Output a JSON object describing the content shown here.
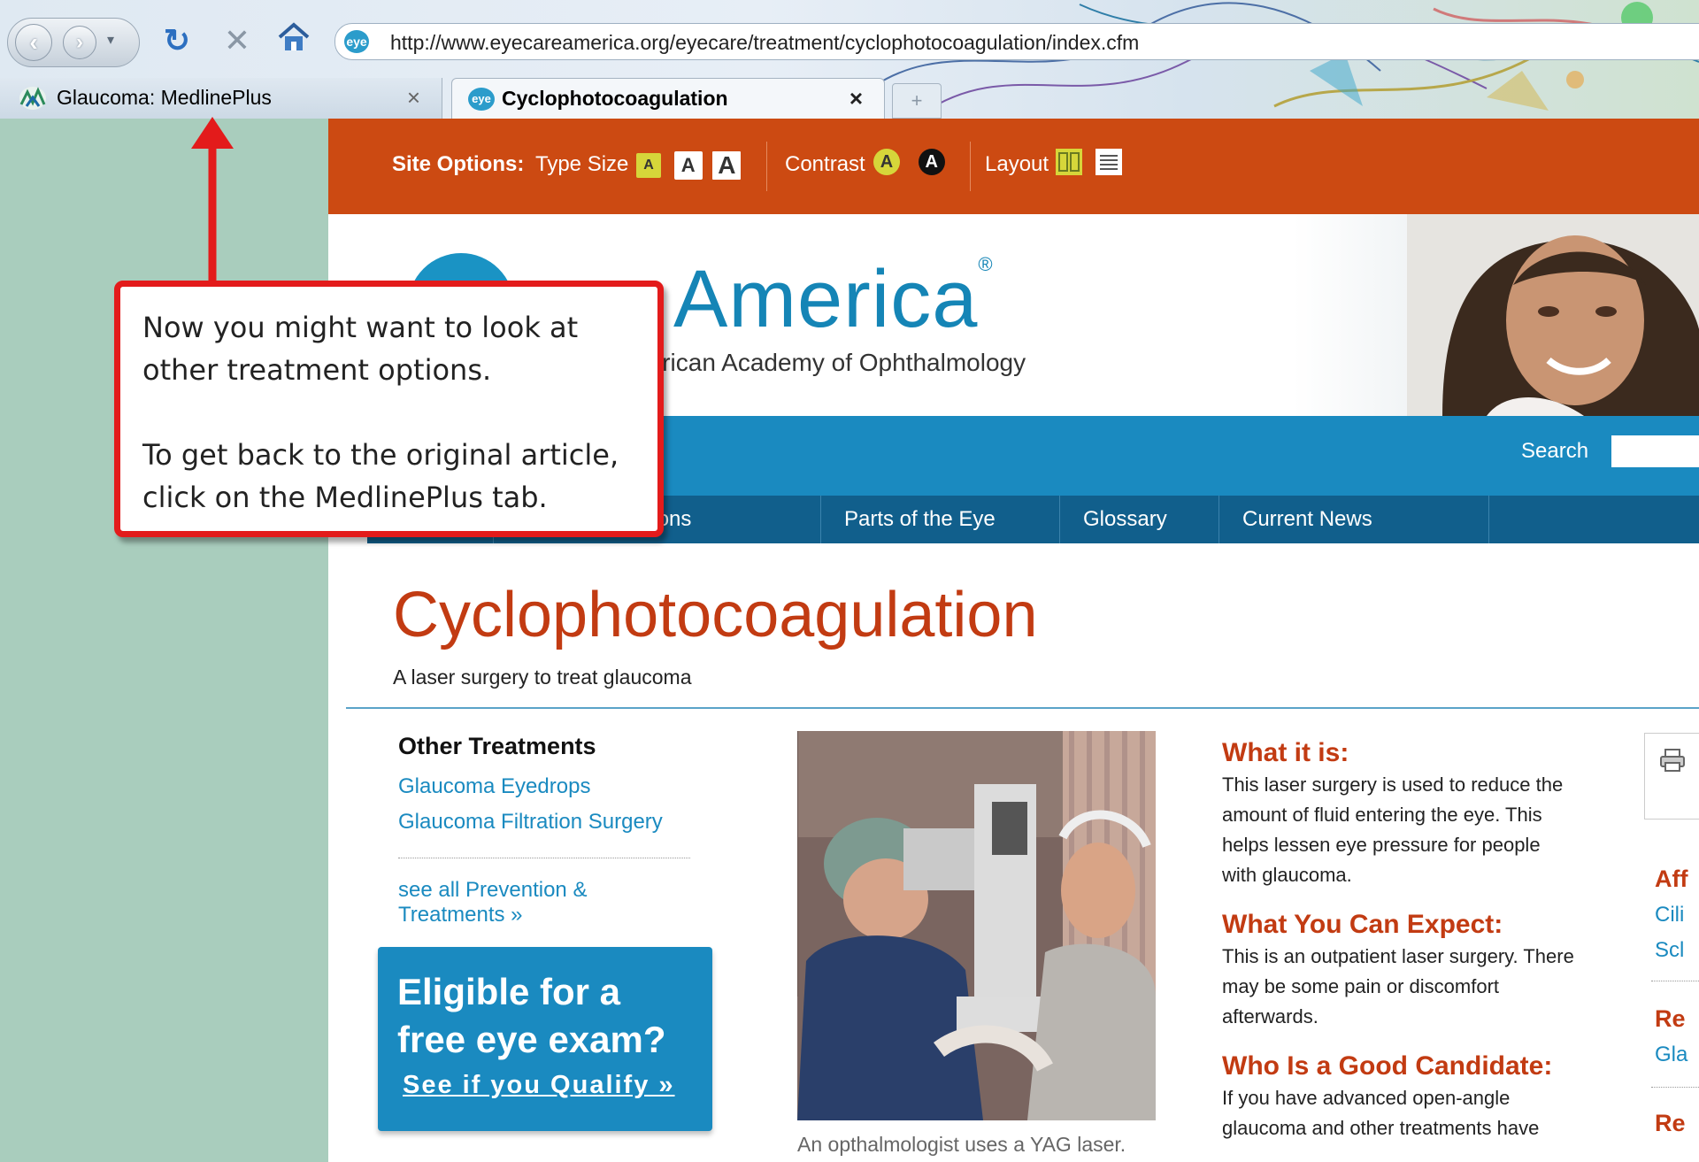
{
  "browser": {
    "url": "http://www.eyecareamerica.org/eyecare/treatment/cyclophotocoagulation/index.cfm",
    "url_favicon_text": "eye",
    "tabs": [
      {
        "label": "Glaucoma: MedlinePlus",
        "close": "×"
      },
      {
        "label": "Cyclophotocoagulation",
        "close": "×",
        "favicon_text": "eye"
      }
    ],
    "new_tab": "+"
  },
  "site_options": {
    "label": "Site Options:",
    "type_size_label": "Type Size",
    "type_size_options": [
      "A",
      "A",
      "A"
    ],
    "contrast_label": "Contrast",
    "contrast_options": [
      "A",
      "A"
    ],
    "layout_label": "Layout"
  },
  "header": {
    "logo_text": "America",
    "logo_registered": "®",
    "logo_subtitle": "n of the American Academy of Ophthalmology"
  },
  "search": {
    "label": "Search",
    "value": ""
  },
  "nav": [
    "Conditions",
    "Parts of the Eye",
    "Glossary",
    "Current News"
  ],
  "page": {
    "title": "Cyclophotocoagulation",
    "subtitle": "A laser surgery to treat glaucoma"
  },
  "other_treatments": {
    "heading": "Other Treatments",
    "links": [
      "Glaucoma Eyedrops",
      "Glaucoma Filtration Surgery"
    ],
    "see_all": "see all Prevention & Treatments »"
  },
  "promo": {
    "title": "Eligible for a free eye exam?",
    "link": "See if you Qualify »"
  },
  "photo": {
    "caption": "An opthalmologist uses a YAG laser."
  },
  "article": [
    {
      "heading": "What it is:",
      "body": "This laser surgery is used to reduce the amount of fluid entering the eye. This helps lessen eye pressure for people with glaucoma."
    },
    {
      "heading": "What You Can Expect:",
      "body": "This is an outpatient laser surgery. There may be some pain or discomfort afterwards."
    },
    {
      "heading": "Who Is a Good Candidate:",
      "body": "If you have advanced open-angle glaucoma and other treatments have"
    }
  ],
  "sidebar": {
    "affected_heading": "Aff",
    "affected_links": [
      "Cili",
      "Scl"
    ],
    "related_heading": "Re",
    "related_links": [
      "Gla"
    ],
    "related_heading_2": "Re"
  },
  "annotation": {
    "line1": "Now you might want to look at",
    "line2": "other treatment options.",
    "line3": "To get back to the original article,",
    "line4": "click on the MedlinePlus tab."
  },
  "colors": {
    "orange_bar": "#cc4a12",
    "brand_blue": "#1a8ac0",
    "nav_blue": "#115f8c",
    "title_red": "#c23b12",
    "callout_red": "#e31b1b",
    "page_bg": "#a9cdbd"
  }
}
